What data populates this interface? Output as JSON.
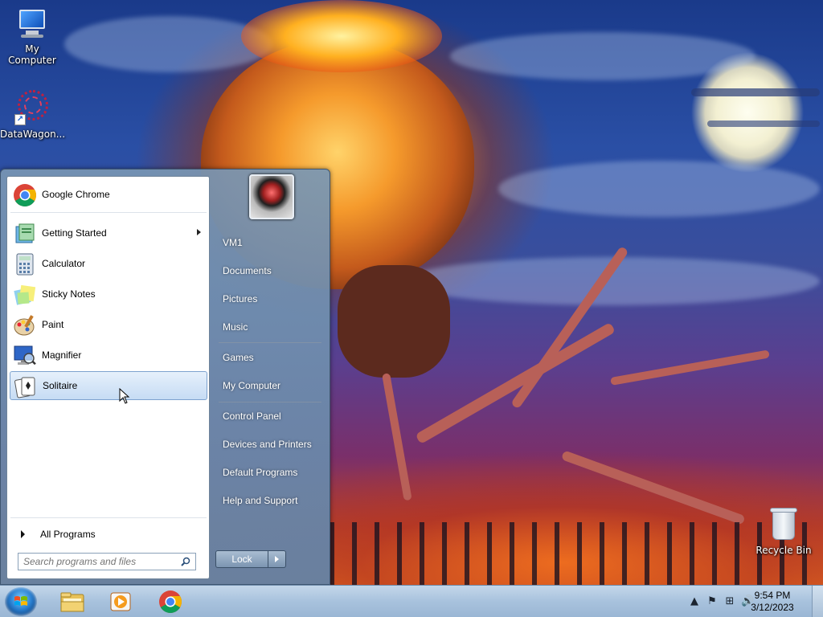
{
  "desktop": {
    "icons": [
      {
        "label": "My Computer",
        "icon": "computer-icon"
      },
      {
        "label": "DataWagon...",
        "icon": "datawagon-shortcut-icon"
      },
      {
        "label": "Recycle Bin",
        "icon": "recycle-bin-icon"
      }
    ]
  },
  "start_menu": {
    "pinned": [
      {
        "label": "Google Chrome",
        "icon": "chrome-icon"
      }
    ],
    "programs": [
      {
        "label": "Getting Started",
        "icon": "getting-started-icon",
        "has_submenu": true
      },
      {
        "label": "Calculator",
        "icon": "calculator-icon"
      },
      {
        "label": "Sticky Notes",
        "icon": "sticky-notes-icon"
      },
      {
        "label": "Paint",
        "icon": "paint-icon"
      },
      {
        "label": "Magnifier",
        "icon": "magnifier-icon"
      },
      {
        "label": "Solitaire",
        "icon": "solitaire-icon",
        "selected": true
      }
    ],
    "all_programs_label": "All Programs",
    "search_placeholder": "Search programs and files",
    "right_items": {
      "user": "VM1",
      "documents": "Documents",
      "pictures": "Pictures",
      "music": "Music",
      "games": "Games",
      "my_computer": "My Computer",
      "control_panel": "Control Panel",
      "devices_printers": "Devices and Printers",
      "default_programs": "Default Programs",
      "help_support": "Help and Support"
    },
    "lock_label": "Lock"
  },
  "taskbar": {
    "apps": [
      {
        "name": "Windows Explorer",
        "icon": "explorer-folder-icon"
      },
      {
        "name": "Windows Media Player",
        "icon": "media-player-icon"
      },
      {
        "name": "Google Chrome",
        "icon": "chrome-icon"
      }
    ],
    "clock": {
      "time": "9:54 PM",
      "date": "3/12/2023"
    },
    "tray_icons": [
      "show-hidden-icon",
      "action-center-flag-icon",
      "network-icon",
      "volume-icon"
    ]
  },
  "colors": {
    "taskbar": "#a8c2dd",
    "selection": "#c6dcf4",
    "start_menu_frame": "#7c95b1"
  }
}
